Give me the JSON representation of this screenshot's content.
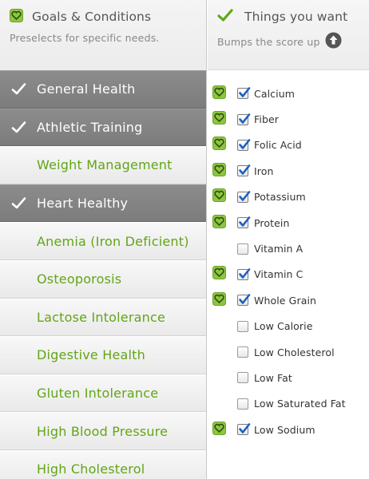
{
  "goals_panel": {
    "title": "Goals & Conditions",
    "subtitle": "Preselects for specific needs.",
    "items": [
      {
        "label": "General Health",
        "selected": true
      },
      {
        "label": "Athletic Training",
        "selected": true
      },
      {
        "label": "Weight Management",
        "selected": false
      },
      {
        "label": "Heart Healthy",
        "selected": true
      },
      {
        "label": "Anemia (Iron Deficient)",
        "selected": false
      },
      {
        "label": "Osteoporosis",
        "selected": false
      },
      {
        "label": "Lactose Intolerance",
        "selected": false
      },
      {
        "label": "Digestive Health",
        "selected": false
      },
      {
        "label": "Gluten Intolerance",
        "selected": false
      },
      {
        "label": "High Blood Pressure",
        "selected": false
      },
      {
        "label": "High Cholesterol",
        "selected": false
      }
    ]
  },
  "wants_panel": {
    "title": "Things you want",
    "subtitle": "Bumps the score up",
    "items": [
      {
        "label": "Calcium",
        "checked": true,
        "heart": true
      },
      {
        "label": "Fiber",
        "checked": true,
        "heart": true
      },
      {
        "label": "Folic Acid",
        "checked": true,
        "heart": true
      },
      {
        "label": "Iron",
        "checked": true,
        "heart": true
      },
      {
        "label": "Potassium",
        "checked": true,
        "heart": true
      },
      {
        "label": "Protein",
        "checked": true,
        "heart": true
      },
      {
        "label": "Vitamin A",
        "checked": false,
        "heart": false
      },
      {
        "label": "Vitamin C",
        "checked": true,
        "heart": true
      },
      {
        "label": "Whole Grain",
        "checked": true,
        "heart": true
      },
      {
        "label": "Low Calorie",
        "checked": false,
        "heart": false
      },
      {
        "label": "Low Cholesterol",
        "checked": false,
        "heart": false
      },
      {
        "label": "Low Fat",
        "checked": false,
        "heart": false
      },
      {
        "label": "Low Saturated Fat",
        "checked": false,
        "heart": false
      },
      {
        "label": "Low Sodium",
        "checked": true,
        "heart": true
      }
    ]
  },
  "icons": {
    "heart_badge": "heart-badge-icon",
    "checkmark": "checkmark-icon",
    "up_arrow": "up-arrow-circle-icon"
  },
  "colors": {
    "accent_green": "#61a617",
    "badge_green": "#8cc63f",
    "selected_row": "#828282",
    "checkbox_blue": "#1f5fbf"
  }
}
